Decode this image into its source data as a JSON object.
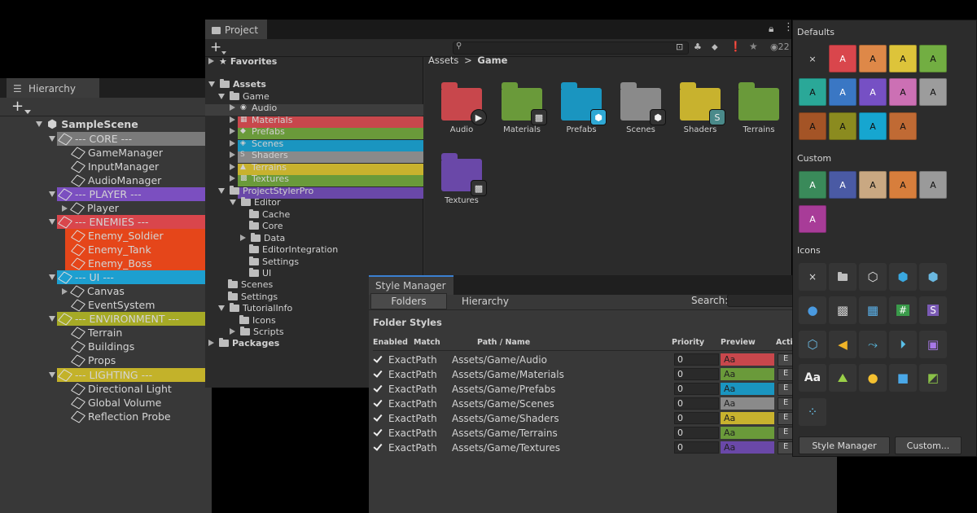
{
  "hierarchy": {
    "tab": "Hierarchy",
    "rows": [
      {
        "label": "SampleScene",
        "bold": true
      },
      {
        "label": "--- CORE ---"
      },
      {
        "label": "GameManager"
      },
      {
        "label": "InputManager"
      },
      {
        "label": "AudioManager"
      },
      {
        "label": "--- PLAYER ---"
      },
      {
        "label": "Player"
      },
      {
        "label": "--- ENEMIES ---"
      },
      {
        "label": "Enemy_Soldier"
      },
      {
        "label": "Enemy_Tank"
      },
      {
        "label": "Enemy_Boss"
      },
      {
        "label": "--- UI ---"
      },
      {
        "label": "Canvas"
      },
      {
        "label": "EventSystem"
      },
      {
        "label": "--- ENVIRONMENT ---"
      },
      {
        "label": "Terrain"
      },
      {
        "label": "Buildings"
      },
      {
        "label": "Props"
      },
      {
        "label": "--- LIGHTING ---"
      },
      {
        "label": "Directional Light"
      },
      {
        "label": "Global Volume"
      },
      {
        "label": "Reflection Probe"
      }
    ]
  },
  "project": {
    "tab": "Project",
    "search_count": "22",
    "tree": [
      "Favorites",
      "Assets",
      "Game",
      "Audio",
      "Materials",
      "Prefabs",
      "Scenes",
      "Shaders",
      "Terrains",
      "Textures",
      "ProjectStylerPro",
      "Editor",
      "Cache",
      "Core",
      "Data",
      "EditorIntegration",
      "Settings",
      "UI",
      "Scenes",
      "Settings",
      "TutorialInfo",
      "Icons",
      "Scripts",
      "Packages"
    ],
    "breadcrumb": {
      "root": "Assets",
      "sep": ">",
      "current": "Game"
    },
    "folders": [
      {
        "name": "Audio",
        "color": "#c8474c"
      },
      {
        "name": "Materials",
        "color": "#6a9a3a"
      },
      {
        "name": "Prefabs",
        "color": "#1a95c0"
      },
      {
        "name": "Scenes",
        "color": "#8a8a8a"
      },
      {
        "name": "Shaders",
        "color": "#c8b22e"
      },
      {
        "name": "Terrains",
        "color": "#6a9a3a"
      },
      {
        "name": "Textures",
        "color": "#6a48a8"
      }
    ]
  },
  "style_manager": {
    "tab": "Style Manager",
    "tabs": [
      "Folders",
      "Hierarchy"
    ],
    "search_label": "Search:",
    "section": "Folder Styles",
    "columns": [
      "Enabled",
      "Match",
      "Path / Name",
      "Priority",
      "Preview",
      "Actio"
    ],
    "rows": [
      {
        "match": "ExactPath",
        "path": "Assets/Game/Audio",
        "priority": "0",
        "preview": "Aa",
        "color": "#c8474c",
        "action": "E"
      },
      {
        "match": "ExactPath",
        "path": "Assets/Game/Materials",
        "priority": "0",
        "preview": "Aa",
        "color": "#6a9a3a",
        "action": "E"
      },
      {
        "match": "ExactPath",
        "path": "Assets/Game/Prefabs",
        "priority": "0",
        "preview": "Aa",
        "color": "#1a95c0",
        "action": "E"
      },
      {
        "match": "ExactPath",
        "path": "Assets/Game/Scenes",
        "priority": "0",
        "preview": "Aa",
        "color": "#8a8a8a",
        "action": "E"
      },
      {
        "match": "ExactPath",
        "path": "Assets/Game/Shaders",
        "priority": "0",
        "preview": "Aa",
        "color": "#c8b22e",
        "action": "E"
      },
      {
        "match": "ExactPath",
        "path": "Assets/Game/Terrains",
        "priority": "0",
        "preview": "Aa",
        "color": "#6a9a3a",
        "action": "E"
      },
      {
        "match": "ExactPath",
        "path": "Assets/Game/Textures",
        "priority": "0",
        "preview": "Aa",
        "color": "#6a48a8",
        "action": "E"
      }
    ]
  },
  "palette": {
    "defaults_label": "Defaults",
    "custom_label": "Custom",
    "icons_label": "Icons",
    "swatch_letter": "A",
    "clear_glyph": "×",
    "defaults": [
      "#2c2c2c",
      "#d9464c",
      "#de8848",
      "#ddc43a",
      "#72ae42",
      "#2aa898",
      "#3a77c4",
      "#7650c4",
      "#cc70b4",
      "#9c9c9c",
      "#a45426",
      "#8b8b1f",
      "#16a6d0",
      "#c06a34"
    ],
    "custom": [
      "#3a8a5a",
      "#4a5aa4",
      "#c9a882",
      "#d77e3c",
      "#9a9a9a",
      "#a83c98"
    ],
    "icons": [
      "×",
      "folder-icon",
      "unity-cube-icon",
      "prefab-cube-icon",
      "prefab-variant-icon",
      "sphere-material-icon",
      "checker-texture-icon",
      "grid-icon",
      "hash-script-icon",
      "shader-s-icon",
      "cube-script-icon",
      "audio-icon",
      "branch-icon",
      "play-circle-icon",
      "bounds-icon",
      "text-Aa-icon",
      "terrain-icon",
      "light-bulb-icon",
      "camera-icon",
      "terrain-data-icon",
      "particles-icon"
    ],
    "style_manager_btn": "Style Manager",
    "custom_btn": "Custom..."
  }
}
